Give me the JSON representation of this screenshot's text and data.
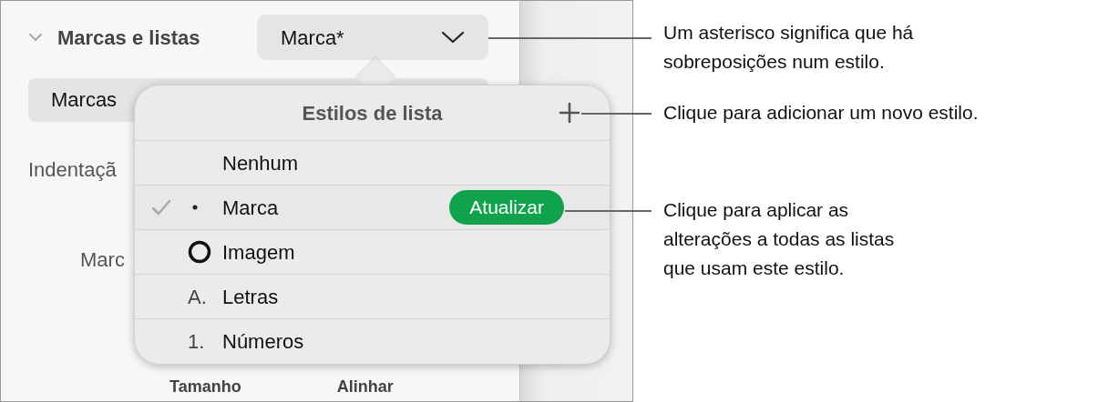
{
  "panel": {
    "section_title": "Marcas e listas",
    "expanded": true,
    "dropdown": {
      "value": "Marca*"
    },
    "style_field": {
      "value": "Marcas"
    },
    "indent_label": "Indentaçã",
    "bullet_label": "Marc",
    "bottom_labels": [
      "Tamanho",
      "Alinhar"
    ]
  },
  "popover": {
    "title": "Estilos de lista",
    "items": [
      {
        "label": "Nenhum",
        "kind": "none",
        "selected": false
      },
      {
        "label": "Marca",
        "kind": "bullet",
        "selected": true,
        "action": "Atualizar"
      },
      {
        "label": "Imagem",
        "kind": "image",
        "selected": false
      },
      {
        "label": "Letras",
        "kind": "text",
        "marker": "A.",
        "selected": false
      },
      {
        "label": "Números",
        "kind": "text",
        "marker": "1.",
        "selected": false
      }
    ]
  },
  "callouts": [
    {
      "lines": [
        "Um asterisco significa que há",
        "sobreposições num estilo."
      ]
    },
    {
      "lines": [
        "Clique para adicionar um novo estilo."
      ]
    },
    {
      "lines": [
        "Clique para aplicar as",
        "alterações a todas as listas",
        "que usam este estilo."
      ]
    }
  ]
}
